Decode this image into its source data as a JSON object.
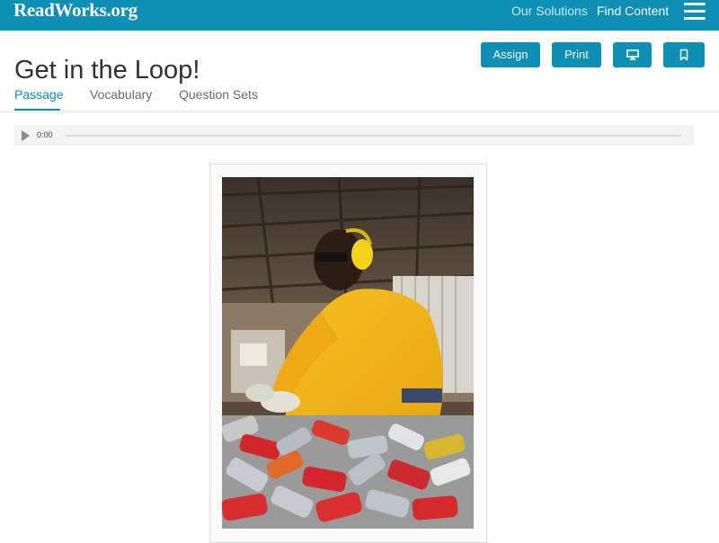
{
  "nav": {
    "logo": "ReadWorks.org",
    "links": [
      "Our Solutions",
      "Find Content"
    ],
    "menu_icon": "hamburger-icon"
  },
  "page": {
    "title": "Get in the Loop!"
  },
  "actions": {
    "assign": "Assign",
    "print": "Print",
    "present_icon": "monitor-icon",
    "bookmark_icon": "bookmark-icon"
  },
  "tabs": [
    {
      "label": "Passage",
      "active": true
    },
    {
      "label": "Vocabulary",
      "active": false
    },
    {
      "label": "Question Sets",
      "active": false
    }
  ],
  "audio": {
    "time": "0:00",
    "progress": 0
  },
  "colors": {
    "brand": "#0e8fb5",
    "shirt": "#f2b318",
    "earmuffs": "#f5d21a"
  }
}
